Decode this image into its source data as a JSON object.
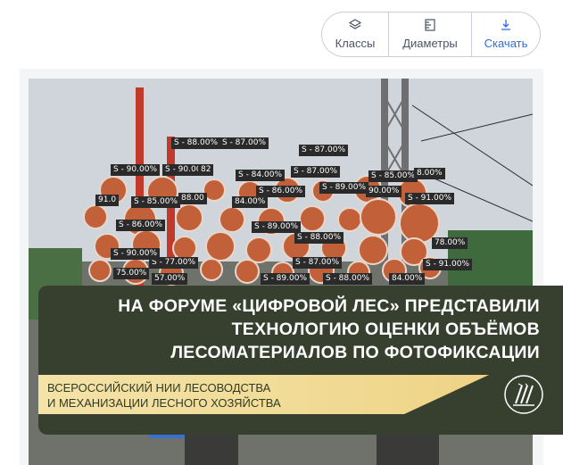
{
  "toolbar": {
    "classes_label": "Классы",
    "diameters_label": "Диаметры",
    "download_label": "Скачать"
  },
  "detections": [
    {
      "text": "S - 88.00%"
    },
    {
      "text": "S - 87.00%"
    },
    {
      "text": "S - 87.00%"
    },
    {
      "text": "S - 90.00%"
    },
    {
      "text": "S - 90.00%"
    },
    {
      "text": "82"
    },
    {
      "text": "S - 84.00%"
    },
    {
      "text": "S - 87.00%"
    },
    {
      "text": "S - 85.00%"
    },
    {
      "text": "8.00%"
    },
    {
      "text": "S - 86.00%"
    },
    {
      "text": "S - 89.00%"
    },
    {
      "text": "90.00%"
    },
    {
      "text": "S - 91.00%"
    },
    {
      "text": "91.0"
    },
    {
      "text": "S - 85.00%"
    },
    {
      "text": "88.00"
    },
    {
      "text": "84.00%"
    },
    {
      "text": "S - 86.00%"
    },
    {
      "text": "S - 89.00%"
    },
    {
      "text": "S - 88.00%"
    },
    {
      "text": "S - 87.00%"
    },
    {
      "text": "S - 89.00%"
    },
    {
      "text": "78.00%"
    },
    {
      "text": "S - 77.00%"
    },
    {
      "text": "S - 90.00%"
    },
    {
      "text": "75.00%"
    },
    {
      "text": "S - 91.00%"
    },
    {
      "text": "84.00%"
    },
    {
      "text": "S - 88.00%"
    },
    {
      "text": "S - 89.00%"
    },
    {
      "text": "57.00%"
    }
  ],
  "banner": {
    "headline": "НА ФОРУМЕ «ЦИФРОВОЙ ЛЕС» ПРЕДСТАВИЛИ\nТЕХНОЛОГИЮ ОЦЕНКИ ОБЪЁМОВ\nЛЕСОМАТЕРИАЛОВ ПО ФОТОФИКСАЦИИ",
    "org": "ВСЕРОССИЙСКИЙ НИИ ЛЕСОВОДСТВА\nИ МЕХАНИЗАЦИИ ЛЕСНОГО ХОЗЯЙСТВА"
  },
  "colors": {
    "banner_bg": "#37402f",
    "org_bar": "#f1dc97",
    "accent_blue": "#2f6fd6",
    "log_end": "#c2603a"
  }
}
